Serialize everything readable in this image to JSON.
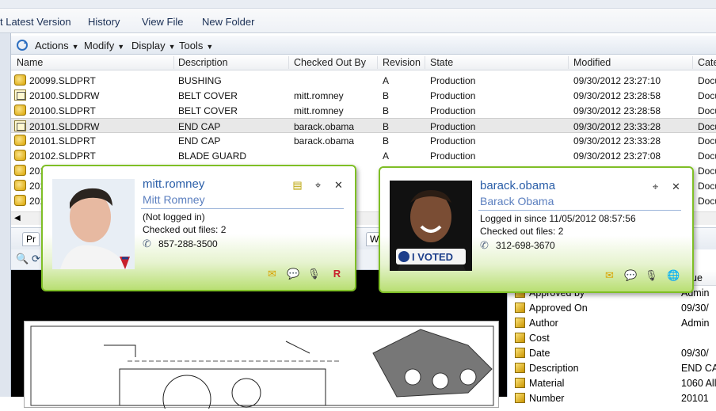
{
  "menu": {
    "items": [
      "t Latest Version",
      "History",
      "View File",
      "New Folder"
    ]
  },
  "toolbar": {
    "items": [
      "Actions",
      "Modify",
      "Display",
      "Tools"
    ]
  },
  "grid": {
    "columns": [
      "Name",
      "Description",
      "Checked Out By",
      "Revision",
      "State",
      "Modified",
      "Cate"
    ],
    "rows": [
      {
        "name": "20099.SLDPRT",
        "description": "BUSHING",
        "checked_out_by": "",
        "revision": "A",
        "state": "Production",
        "modified": "09/30/2012 23:27:10",
        "category": "Docu",
        "type": "part"
      },
      {
        "name": "20100.SLDDRW",
        "description": "BELT COVER",
        "checked_out_by": "mitt.romney",
        "revision": "B",
        "state": "Production",
        "modified": "09/30/2012 23:28:58",
        "category": "Docu",
        "type": "drawing"
      },
      {
        "name": "20100.SLDPRT",
        "description": "BELT COVER",
        "checked_out_by": "mitt.romney",
        "revision": "B",
        "state": "Production",
        "modified": "09/30/2012 23:28:58",
        "category": "Docu",
        "type": "part"
      },
      {
        "name": "20101.SLDDRW",
        "description": "END CAP",
        "checked_out_by": "barack.obama",
        "revision": "B",
        "state": "Production",
        "modified": "09/30/2012 23:33:28",
        "category": "Docu",
        "type": "drawing"
      },
      {
        "name": "20101.SLDPRT",
        "description": "END CAP",
        "checked_out_by": "barack.obama",
        "revision": "B",
        "state": "Production",
        "modified": "09/30/2012 23:33:28",
        "category": "Docu",
        "type": "part"
      },
      {
        "name": "20102.SLDPRT",
        "description": "BLADE GUARD",
        "checked_out_by": "",
        "revision": "A",
        "state": "Production",
        "modified": "09/30/2012 23:27:08",
        "category": "Docu",
        "type": "part"
      },
      {
        "name": "201",
        "description": "",
        "checked_out_by": "",
        "revision": "",
        "state": "",
        "modified": "",
        "category": "Docu",
        "type": "part"
      },
      {
        "name": "201",
        "description": "",
        "checked_out_by": "",
        "revision": "",
        "state": "",
        "modified": "",
        "category": "Docu",
        "type": "part"
      },
      {
        "name": "201",
        "description": "",
        "checked_out_by": "",
        "revision": "",
        "state": "",
        "modified": "",
        "category": "Docu",
        "type": "part"
      }
    ]
  },
  "tabs": {
    "preview": "Pr",
    "other": "W"
  },
  "properties": {
    "value_header": "ue",
    "rows": [
      {
        "name": "Approved by",
        "value": "Admin"
      },
      {
        "name": "Approved On",
        "value": "09/30/"
      },
      {
        "name": "Author",
        "value": "Admin"
      },
      {
        "name": "Cost",
        "value": ""
      },
      {
        "name": "Date",
        "value": "09/30/"
      },
      {
        "name": "Description",
        "value": "END CA"
      },
      {
        "name": "Material",
        "value": "1060 All"
      },
      {
        "name": "Number",
        "value": "20101"
      }
    ]
  },
  "cards": {
    "romney": {
      "username": "mitt.romney",
      "fullname": "Mitt Romney",
      "status": "(Not logged in)",
      "checked_out": "Checked out files: 2",
      "phone": "857-288-3500"
    },
    "obama": {
      "username": "barack.obama",
      "fullname": "Barack Obama",
      "status": "Logged in since 11/05/2012 08:57:56",
      "checked_out": "Checked out files: 2",
      "phone": "312-698-3670",
      "photo_caption": "I VOTED"
    }
  }
}
